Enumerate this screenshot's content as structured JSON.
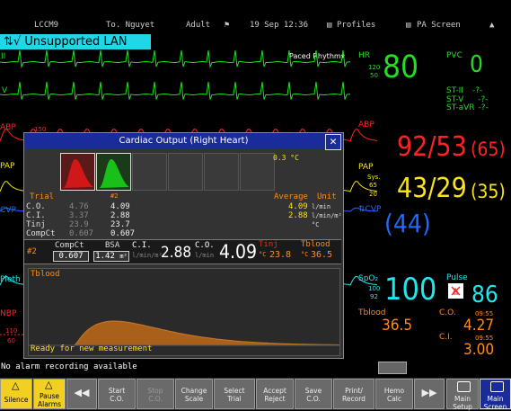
{
  "topbar": {
    "bed": "LCCM9",
    "patient": "To. Nguyet",
    "category": "Adult",
    "datetime": "19 Sep 12:36",
    "profiles": "Profiles",
    "screen": "PA Screen"
  },
  "lan_status": "Unsupported LAN",
  "waves": {
    "ii_label": "II",
    "v_label": "V",
    "paced": "Paced",
    "rhythm": "Rhythm",
    "abp_label": "ABP",
    "abp_scale": "150",
    "pap_label": "PAP",
    "cvp_label": "CVP",
    "pleth_label": "Pleth",
    "nbp_label": "NBP",
    "nbp_scale": "110",
    "nbp_scale2": "60"
  },
  "vitals": {
    "hr_label": "HR",
    "hr_hi": "120",
    "hr_lo": "50",
    "hr_value": "80",
    "pvc_label": "PVC",
    "pvc_value": "0",
    "st_ii": "ST-II",
    "st_ii_val": "-?-",
    "st_v": "ST-V",
    "st_v_val": "-?-",
    "st_avr": "ST-aVR",
    "st_avr_val": "-?-",
    "abp_value": "92/53",
    "abp_mean": "(65)",
    "pap_label": "PAP",
    "pap_sys": "Sys.",
    "pap_hi": "65",
    "pap_lo": "20",
    "pap_value": "43/29",
    "pap_mean": "(35)",
    "cvp_label": "CVP",
    "cvp_value": "(44)",
    "spo2_label": "SpO₂",
    "spo2_hi": "100",
    "spo2_lo": "92",
    "spo2_value": "100",
    "pulse_label": "Pulse",
    "pulse_value": "86",
    "tblood_label": "Tblood",
    "tblood_value": "36.5",
    "co_label": "C.O.",
    "co_time": "09:55",
    "co_value": "4.27",
    "ci_label": "C.I.",
    "ci_time": "09:55",
    "ci_value": "3.00"
  },
  "dialog": {
    "title": "Cardiac Output (Right Heart)",
    "temp_note": "0.3 °C",
    "trial_header": "Trial",
    "trial_num": "#2",
    "average_header": "Average",
    "unit_header": "Unit",
    "rows": [
      {
        "label": "C.O.",
        "t1": "4.76",
        "t2": "4.09",
        "avg": "4.09",
        "unit": "l/min"
      },
      {
        "label": "C.I.",
        "t1": "3.37",
        "t2": "2.88",
        "avg": "2.88",
        "unit": "l/min/m²"
      },
      {
        "label": "Tinj",
        "t1": "23.9",
        "t2": "23.7",
        "avg": "",
        "unit": "°C"
      },
      {
        "label": "CompCt",
        "t1": "0.607",
        "t2": "0.607",
        "avg": "",
        "unit": ""
      }
    ],
    "sel_num": "#2",
    "compct_label": "CompCt",
    "compct_value": "0.607",
    "bsa_label": "BSA",
    "bsa_value": "1.42",
    "bsa_unit": "m²",
    "ci_label": "C.I.",
    "ci_unit": "l/min/m²",
    "ci_value": "2.88",
    "co_label": "C.O.",
    "co_unit": "l/min",
    "co_value": "4.09",
    "tinj_label": "Tinj",
    "tinj_value": "23.8",
    "tinj_unit": "°C",
    "tblood_label": "Tblood",
    "tblood_value": "36.5",
    "tblood_unit": "°C",
    "graph_label": "Tblood",
    "status": "Ready for new measurement"
  },
  "alarm_msg": "No alarm recording available",
  "buttons": [
    {
      "line1": "Silence",
      "line2": ""
    },
    {
      "line1": "Pause",
      "line2": "Alarms"
    },
    {
      "line1": "Start",
      "line2": "C.O."
    },
    {
      "line1": "Stop",
      "line2": "C.O."
    },
    {
      "line1": "Change",
      "line2": "Scale"
    },
    {
      "line1": "Select",
      "line2": "Trial"
    },
    {
      "line1": "Accept",
      "line2": "Reject"
    },
    {
      "line1": "Save",
      "line2": "C.O."
    },
    {
      "line1": "Print/",
      "line2": "Record"
    },
    {
      "line1": "Hemo",
      "line2": "Calc"
    },
    {
      "line1": "Main",
      "line2": "Setup"
    },
    {
      "line1": "Main",
      "line2": "Screen"
    }
  ],
  "colors": {
    "ecg": "#22dd22",
    "abp": "#ff2222",
    "pap": "#f7e21c",
    "cvp": "#1e6aff",
    "spo2": "#22e6ee",
    "pulse": "#22e6ee",
    "tblood": "#ff8c1a"
  }
}
